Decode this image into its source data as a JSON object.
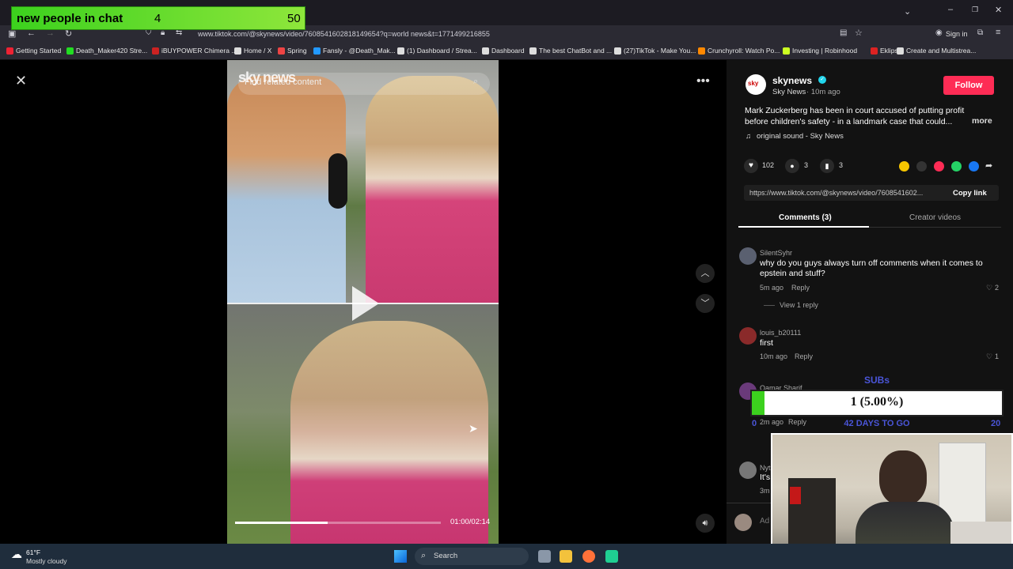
{
  "browser": {
    "url": "www.tiktok.com/@skynews/video/7608541602818149654?q=world news&t=1771499216855",
    "signin": "Sign in",
    "bookmarks": [
      {
        "label": "Getting Started",
        "color": "#e23"
      },
      {
        "label": "Death_Maker420 Stre...",
        "color": "#2d2"
      },
      {
        "label": "iBUYPOWER Chimera ...",
        "color": "#c22"
      },
      {
        "label": "Home / X",
        "color": "#ddd"
      },
      {
        "label": "Spring",
        "color": "#e44"
      },
      {
        "label": "Fansly - @Death_Mak...",
        "color": "#29f"
      },
      {
        "label": "(1) Dashboard / Strea...",
        "color": "#ddd"
      },
      {
        "label": "Dashboard",
        "color": "#ddd"
      },
      {
        "label": "The best ChatBot and ...",
        "color": "#ddd"
      },
      {
        "label": "(27)TikTok - Make You...",
        "color": "#ddd"
      },
      {
        "label": "Crunchyroll: Watch Po...",
        "color": "#f80"
      },
      {
        "label": "Investing | Robinhood",
        "color": "#cf2"
      },
      {
        "label": "Eklipse",
        "color": "#d22"
      },
      {
        "label": "Create and Multistrea...",
        "color": "#ddd"
      }
    ]
  },
  "overlay": {
    "chat_label": "new people in chat",
    "chat_count": "4",
    "chat_goal": "50",
    "subs_title": "SUBs",
    "subs_value": "1 (5.00%)",
    "subs_progress": 0.05,
    "subs_days": "42 DAYS TO GO",
    "subs_left": "0",
    "subs_right": "20"
  },
  "video": {
    "search_placeholder": "Find related content",
    "watermark": "sky news",
    "time": "01:00/02:14",
    "progress": 0.45
  },
  "author": {
    "name": "skynews",
    "display": "Sky News",
    "ago": "10m ago",
    "follow": "Follow",
    "caption": "Mark Zuckerberg has been in court accused of putting profit before children's safety - in a landmark case that could...",
    "more": "more",
    "sound": "original sound - Sky News"
  },
  "stats": {
    "likes": "102",
    "comments": "3",
    "saves": "3"
  },
  "link": {
    "url": "https://www.tiktok.com/@skynews/video/7608541602...",
    "copy": "Copy link"
  },
  "tabs": {
    "comments": "Comments (3)",
    "creator": "Creator videos"
  },
  "comments": [
    {
      "user": "SilentSyhr",
      "text": "why do you guys always turn off comments when it comes to epstein and stuff?",
      "ago": "5m ago",
      "reply": "Reply",
      "likes": "2",
      "view_replies": "View 1 reply"
    },
    {
      "user": "louis_b20111",
      "text": "first",
      "ago": "10m ago",
      "reply": "Reply",
      "likes": "1"
    },
    {
      "user": "Qamar Sharif",
      "ago": "2m ago",
      "reply": "Reply"
    },
    {
      "user": "Nyt",
      "text": "It's",
      "ago": "3m"
    }
  ],
  "add_comment": "Ad",
  "taskbar": {
    "temp": "61°F",
    "weather": "Mostly cloudy",
    "search": "Search"
  }
}
